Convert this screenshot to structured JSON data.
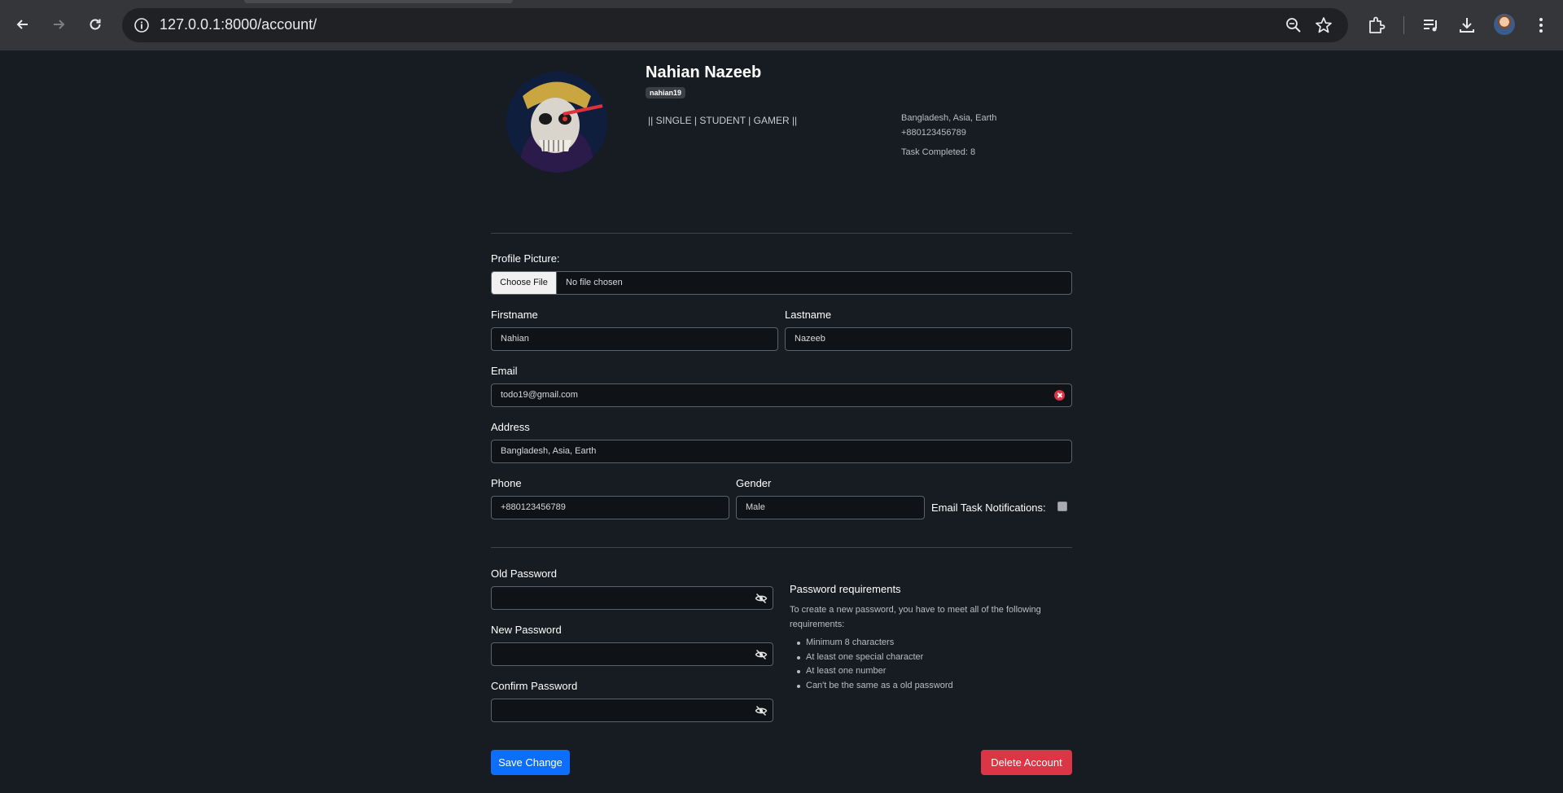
{
  "browser": {
    "url": "127.0.0.1:8000/account/"
  },
  "profile": {
    "name": "Nahian Nazeeb",
    "username": "nahian19",
    "bio": "|| SINGLE | STUDENT | GAMER ||",
    "location": "Bangladesh, Asia, Earth",
    "phone": "+880123456789",
    "task_completed": "Task Completed: 8"
  },
  "form": {
    "profile_picture_label": "Profile Picture:",
    "choose_file_label": "Choose File",
    "no_file_text": "No file chosen",
    "firstname_label": "Firstname",
    "firstname_value": "Nahian",
    "lastname_label": "Lastname",
    "lastname_value": "Nazeeb",
    "email_label": "Email",
    "email_value": "todo19@gmail.com",
    "address_label": "Address",
    "address_value": "Bangladesh, Asia, Earth",
    "phone_label": "Phone",
    "phone_value": "+880123456789",
    "gender_label": "Gender",
    "gender_value": "Male",
    "email_notif_label": "Email Task Notifications:"
  },
  "password": {
    "old_label": "Old Password",
    "new_label": "New Password",
    "confirm_label": "Confirm Password",
    "req_title": "Password requirements",
    "req_text": "To create a new password, you have to meet all of the following requirements:",
    "requirements": [
      "Minimum 8 characters",
      "At least one special character",
      "At least one number",
      "Can't be the same as a old password"
    ]
  },
  "actions": {
    "save_label": "Save Change",
    "delete_label": "Delete Account"
  },
  "colors": {
    "background": "#171b22",
    "primary": "#0d6efd",
    "danger": "#dc3545"
  }
}
